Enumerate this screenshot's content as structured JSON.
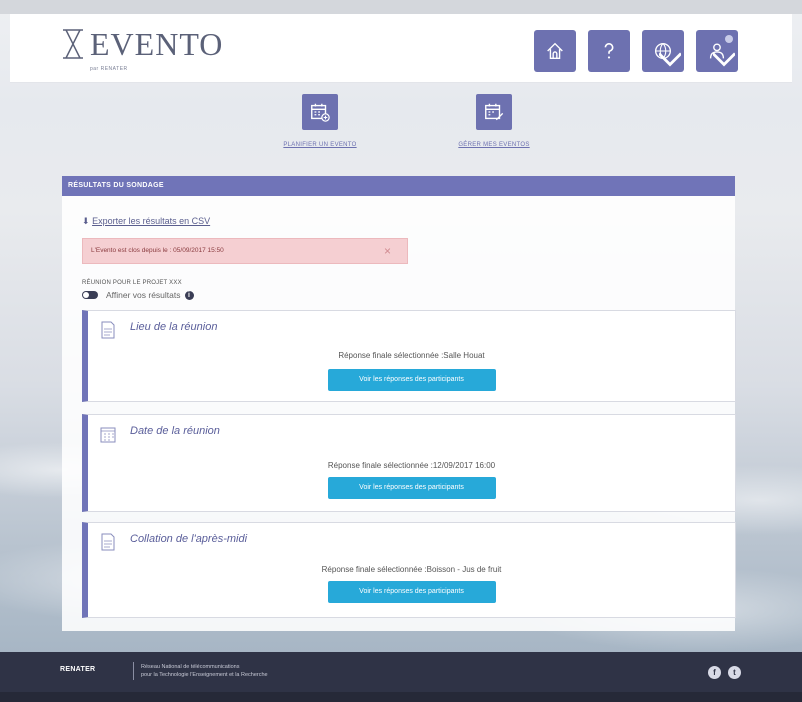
{
  "brand": {
    "name": "EVENTO",
    "sub": "par RENATER"
  },
  "header_buttons": [
    {
      "name": "home",
      "icon": "home-icon"
    },
    {
      "name": "help",
      "icon": "question-icon"
    },
    {
      "name": "language",
      "icon": "globe-icon"
    },
    {
      "name": "user",
      "icon": "user-icon"
    }
  ],
  "actions": {
    "plan_label": "PLANIFIER UN EVENTO",
    "manage_label": "GÉRER MES EVENTOS"
  },
  "panel": {
    "title": "RÉSULTATS DU SONDAGE",
    "export_label": "Exporter les résultats en CSV",
    "alert_text": "L'Evento est clos depuis le : 05/09/2017 15:50",
    "alert_close": "×",
    "meeting_title": "RÉUNION POUR LE PROJET XXX",
    "refine_label": "Affiner vos résultats",
    "info_glyph": "i"
  },
  "questions": [
    {
      "title": "Lieu de la réunion",
      "answer": "Réponse finale sélectionnée :Salle Houat",
      "button": "Voir les réponses des participants"
    },
    {
      "title": "Date de la réunion",
      "answer": "Réponse finale sélectionnée :12/09/2017 16:00",
      "button": "Voir les réponses des participants"
    },
    {
      "title": "Collation de l'après-midi",
      "answer": "Réponse finale sélectionnée :Boisson - Jus de fruit",
      "button": "Voir les réponses des participants"
    }
  ],
  "footer": {
    "org": "RENATER",
    "line1": "Réseau National de télécommunications",
    "line2": "pour la Technologie l'Enseignement et la Recherche",
    "facebook": "f",
    "twitter": "t"
  },
  "colors": {
    "accent": "#7074b8",
    "button": "#27a9d9",
    "alert_bg": "#f5cfd2",
    "footer": "#2f3346"
  }
}
